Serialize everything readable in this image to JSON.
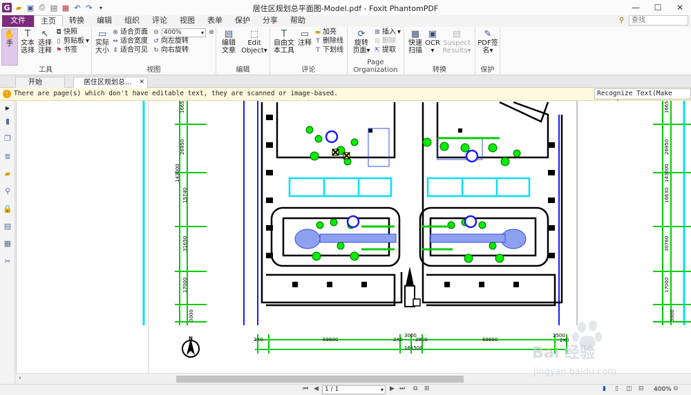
{
  "window": {
    "title": "居住区规划总平面图-Model.pdf - Foxit PhantomPDF",
    "minimize_glyph": "—",
    "maximize_glyph": "☐",
    "close_glyph": "✕"
  },
  "ribbon_tabs": [
    "文件",
    "主页",
    "转换",
    "编辑",
    "组织",
    "评论",
    "视图",
    "表单",
    "保护",
    "分享",
    "帮助"
  ],
  "search": {
    "placeholder": "查找"
  },
  "ribbon": {
    "tools": {
      "label": "工具",
      "hand": "手",
      "select_text": [
        "文本",
        "选择"
      ],
      "select_annotation": [
        "选择",
        "注释"
      ],
      "snapshot": "快照",
      "clipboard": "剪贴板",
      "bookmark": "书签"
    },
    "view": {
      "label": "视图",
      "actual_size": [
        "实际",
        "大小"
      ],
      "fit_page": "适合页面",
      "fit_width": "适合宽度",
      "fit_visible": "适合可见",
      "zoom_value": "400%",
      "rotate_left": "向左旋转",
      "rotate_right": "向右旋转"
    },
    "edit": {
      "label": "编辑",
      "edit_text": [
        "编辑",
        "文章"
      ],
      "edit_object": [
        "Edit",
        "Object"
      ]
    },
    "comment": {
      "label": "评论",
      "typewriter": [
        "自由文",
        "本工具"
      ],
      "note": "注释",
      "highlight": "加亮",
      "strikeout": "删除线",
      "underline": "下划线"
    },
    "page_org": {
      "label": "Page Organization",
      "rotate_page": [
        "旋转",
        "页面"
      ],
      "insert": "插入",
      "delete": "删除",
      "extract": "提取"
    },
    "convert": {
      "label": "转换",
      "quick_scan": [
        "快速",
        "扫描"
      ],
      "ocr": "OCR",
      "suspect": [
        "Suspect",
        "Results"
      ]
    },
    "protect": {
      "label": "保护",
      "pdf_sign": [
        "PDF签",
        "名"
      ]
    }
  },
  "doc_tabs": {
    "start": "开始",
    "current": "居住区规划总..."
  },
  "notice": {
    "message": "There are page(s) which don't have editable text, they are scanned or image-based.",
    "button": "Recognize Text(Make searcha"
  },
  "drawing": {
    "left_dims": [
      "16650",
      "26950",
      "143000",
      "15740",
      "31650",
      "17000",
      "3000"
    ],
    "right_dims": [
      "16650",
      "26950",
      "143000",
      "16630",
      "30760",
      "17000",
      "3000"
    ],
    "bottom_dims": [
      "2X0",
      "69800",
      "2X0",
      "3000",
      "2800",
      "69800",
      "2500",
      "2X0",
      "161500"
    ],
    "north": "N"
  },
  "statusbar": {
    "page": "1 / 1",
    "zoom": "400%"
  },
  "watermark": {
    "brand": "Bai 经验",
    "url": "jingyan.baidu.com"
  },
  "colors": {
    "brand_purple": "#7a2b7b",
    "cad_green": "#00cc00",
    "cad_blue": "#1a1aff",
    "cad_cyan": "#00e0ff"
  }
}
